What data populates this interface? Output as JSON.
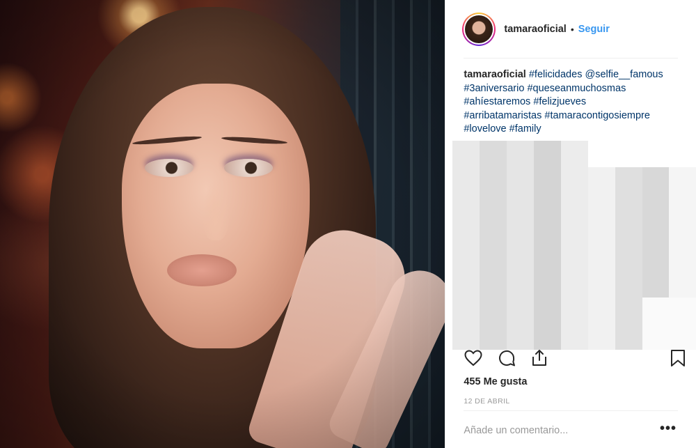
{
  "header": {
    "username": "tamaraoficial",
    "separator": "•",
    "follow_label": "Seguir"
  },
  "caption": {
    "username": "tamaraoficial",
    "lines": [
      [
        "#felicidades",
        "@selfie__famous"
      ],
      [
        "#3aniversario",
        "#queseanmuchosmas"
      ],
      [
        "#ahíestaremos",
        "#felizjueves"
      ],
      [
        "#arribatamaristas",
        "#tamaracontigosiempre"
      ],
      [
        "#lovelove",
        "#family"
      ]
    ]
  },
  "icons": {
    "like": "heart-icon",
    "comment": "comment-icon",
    "share": "share-icon",
    "save": "bookmark-icon",
    "more": "more-options-icon"
  },
  "likes_text": "455 Me gusta",
  "date_text": "12 DE ABRIL",
  "comment": {
    "placeholder": "Añade un comentario...",
    "more_label": "•••"
  },
  "colors": {
    "follow_blue": "#3897f0",
    "hashtag": "#003569",
    "text": "#262626",
    "muted": "#999999"
  }
}
